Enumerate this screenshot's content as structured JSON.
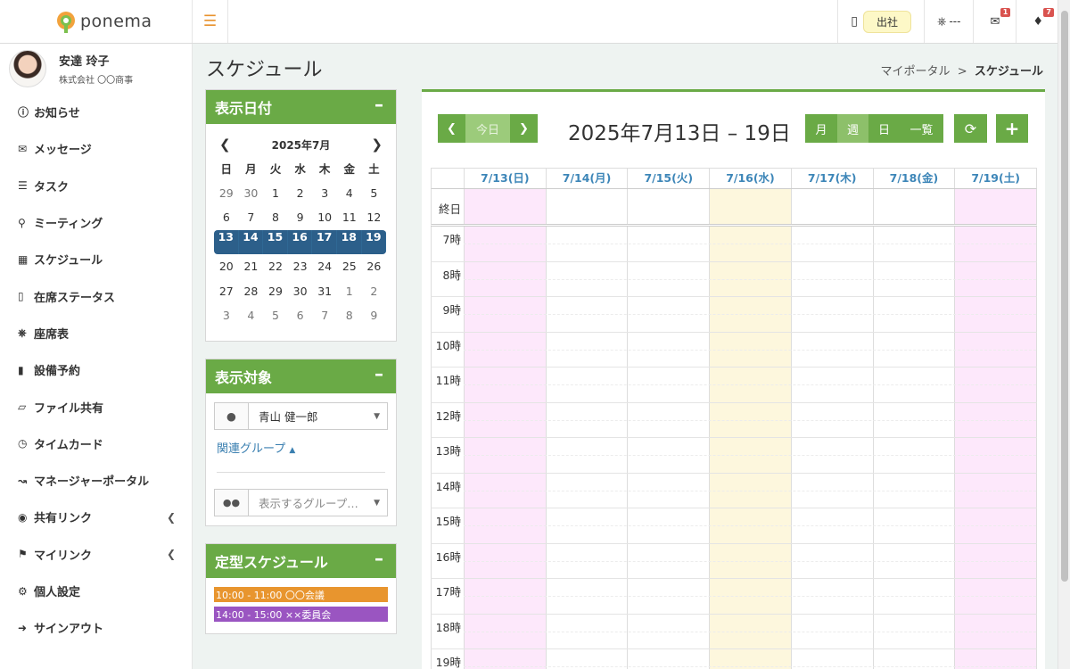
{
  "app": {
    "name": "ponema"
  },
  "topbar": {
    "attendance_label": "出社",
    "seat_label": "---",
    "mail_count": "1",
    "notification_count": "7"
  },
  "user": {
    "name": "安達 玲子",
    "company": "株式会社 〇〇商事"
  },
  "sidebar": {
    "items": [
      {
        "label": "お知らせ",
        "icon": "info-icon"
      },
      {
        "label": "メッセージ",
        "icon": "envelope-icon"
      },
      {
        "label": "タスク",
        "icon": "tasks-icon"
      },
      {
        "label": "ミーティング",
        "icon": "comments-icon"
      },
      {
        "label": "スケジュール",
        "icon": "calendar-icon"
      },
      {
        "label": "在席ステータス",
        "icon": "presence-icon"
      },
      {
        "label": "座席表",
        "icon": "chair-icon"
      },
      {
        "label": "設備予約",
        "icon": "book-icon"
      },
      {
        "label": "ファイル共有",
        "icon": "folder-icon"
      },
      {
        "label": "タイムカード",
        "icon": "clock-icon"
      },
      {
        "label": "マネージャーポータル",
        "icon": "chart-icon"
      },
      {
        "label": "共有リンク",
        "icon": "globe-icon"
      },
      {
        "label": "マイリンク",
        "icon": "bookmark-icon"
      },
      {
        "label": "個人設定",
        "icon": "gear-icon"
      },
      {
        "label": "サインアウト",
        "icon": "sign-out-icon"
      }
    ]
  },
  "page": {
    "title": "スケジュール",
    "breadcrumb_parent": "マイポータル",
    "breadcrumb_sep": ">",
    "breadcrumb_current": "スケジュール"
  },
  "date_panel": {
    "title": "表示日付",
    "month_label": "2025年7月",
    "weekdays": [
      "日",
      "月",
      "火",
      "水",
      "木",
      "金",
      "土"
    ],
    "weeks": [
      [
        "29",
        "30",
        "1",
        "2",
        "3",
        "4",
        "5"
      ],
      [
        "6",
        "7",
        "8",
        "9",
        "10",
        "11",
        "12"
      ],
      [
        "13",
        "14",
        "15",
        "16",
        "17",
        "18",
        "19"
      ],
      [
        "20",
        "21",
        "22",
        "23",
        "24",
        "25",
        "26"
      ],
      [
        "27",
        "28",
        "29",
        "30",
        "31",
        "1",
        "2"
      ],
      [
        "3",
        "4",
        "5",
        "6",
        "7",
        "8",
        "9"
      ]
    ]
  },
  "target_panel": {
    "title": "表示対象",
    "person": "青山 健一郎",
    "related_group_label": "関連グループ",
    "group_placeholder": "表示するグループ…"
  },
  "fixed_panel": {
    "title": "定型スケジュール",
    "items": [
      {
        "label": "10:00 - 11:00 〇〇会議",
        "color": "#e8952e"
      },
      {
        "label": "14:00 - 15:00 ××委員会",
        "color": "#9a55c1"
      }
    ]
  },
  "calendar": {
    "today_label": "今日",
    "range_title": "2025年7月13日 – 19日",
    "view_buttons": [
      "月",
      "週",
      "日",
      "一覧"
    ],
    "active_view": "週",
    "days": [
      "7/13(日)",
      "7/14(月)",
      "7/15(火)",
      "7/16(水)",
      "7/17(木)",
      "7/18(金)",
      "7/19(土)"
    ],
    "allday_label": "終日",
    "hours": [
      "7時",
      "8時",
      "9時",
      "10時",
      "11時",
      "12時",
      "13時",
      "14時",
      "15時",
      "16時",
      "17時",
      "18時",
      "19時"
    ],
    "colors": {
      "accent": "#6aaa46",
      "weekend": "#fde8fb",
      "today": "#fdf7dd",
      "selected_week": "#2c5f8a"
    }
  }
}
